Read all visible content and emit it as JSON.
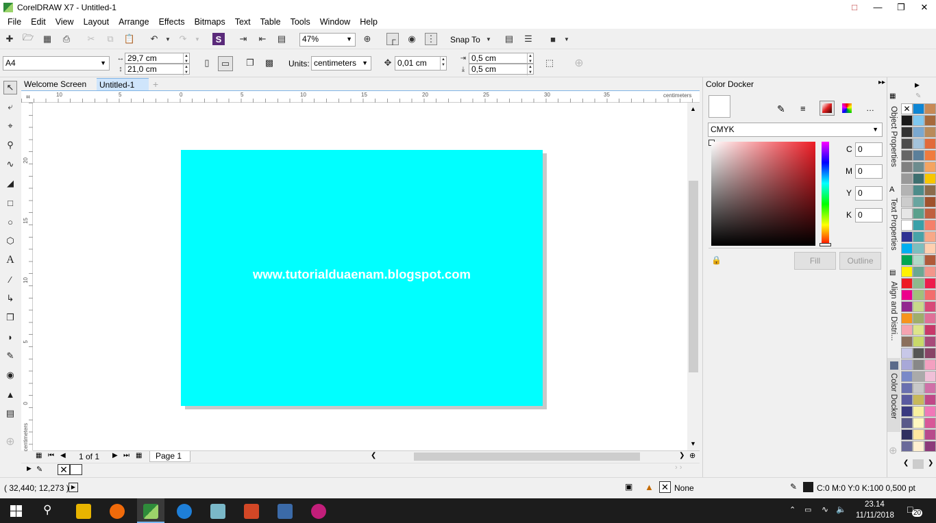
{
  "title": "CorelDRAW X7 - Untitled-1",
  "menu": [
    "File",
    "Edit",
    "View",
    "Layout",
    "Arrange",
    "Effects",
    "Bitmaps",
    "Text",
    "Table",
    "Tools",
    "Window",
    "Help"
  ],
  "toolbar": {
    "zoom": "47%",
    "snap": "Snap To"
  },
  "property_bar": {
    "page_size": "A4",
    "width": "29,7 cm",
    "height": "21,0 cm",
    "units_label": "Units:",
    "units": "centimeters",
    "nudge": "0,01 cm",
    "dup_x": "0,5 cm",
    "dup_y": "0,5 cm"
  },
  "tabs": {
    "welcome": "Welcome Screen",
    "doc": "Untitled-1"
  },
  "ruler": {
    "unit": "centimeters",
    "h_ticks": [
      "10",
      "5",
      "0",
      "5",
      "10",
      "15",
      "20",
      "25",
      "30",
      "35"
    ],
    "v_ticks": [
      "20",
      "15",
      "10",
      "5",
      "0"
    ]
  },
  "canvas": {
    "text": "www.tutorialduaenam.blogspot.com",
    "page_color": "#00FFFF"
  },
  "page_nav": {
    "count": "1 of 1",
    "page_tab": "Page 1"
  },
  "docker": {
    "title": "Color Docker",
    "model": "CMYK",
    "c_label": "C",
    "m_label": "M",
    "y_label": "Y",
    "k_label": "K",
    "c": "0",
    "m": "0",
    "y": "0",
    "k": "0",
    "fill": "Fill",
    "outline": "Outline"
  },
  "side_tabs": [
    "Object Properties",
    "Text Properties",
    "Align and Distri...",
    "Color Docker"
  ],
  "status": {
    "coords": "( 32,440; 12,273 )",
    "fill": "None",
    "outline": "C:0 M:0 Y:0 K:100  0,500 pt"
  },
  "taskbar": {
    "time": "23.14",
    "date": "11/11/2018",
    "notif": "20"
  },
  "palette_colors": [
    "#fff",
    "#0e86d4",
    "#c78a56",
    "#1a1a1a",
    "#7fc8f0",
    "#a66a3c",
    "#333",
    "#7aa8d0",
    "#b98b5a",
    "#4d4d4d",
    "#a3c3dc",
    "#e26a3a",
    "#666",
    "#5b7f9a",
    "#f07b3d",
    "#808080",
    "#6d8c8e",
    "#f4a460",
    "#999",
    "#3d6f6f",
    "#f8c700",
    "#b3b3b3",
    "#4d8c8a",
    "#8c6c4c",
    "#ccc",
    "#69a5a0",
    "#a0522d",
    "#e6e6e6",
    "#5aa08c",
    "#c06040",
    "#fff",
    "#3aa0a8",
    "#f5806a",
    "#2e3192",
    "#47a3a8",
    "#f8a888",
    "#00aeef",
    "#7bbfbf",
    "#ffd0b0",
    "#00a651",
    "#b0d8c8",
    "#b05a3a",
    "#fff200",
    "#6aa892",
    "#f2968c",
    "#ed1c24",
    "#8db98c",
    "#ed1c4c",
    "#ec008c",
    "#a2c07a",
    "#f36d6d",
    "#92278f",
    "#c8d88a",
    "#d84878",
    "#f7941d",
    "#9fae6a",
    "#e07098",
    "#f5a3b0",
    "#dde48a",
    "#c8386a",
    "#8b6f5c",
    "#c8d96a",
    "#a84a7a",
    "#c8c8e8",
    "#555",
    "#884466",
    "#a8a8d8",
    "#888",
    "#f4a0c0",
    "#7a8ac8",
    "#aaa",
    "#f0c0d8",
    "#6a70b0",
    "#c8c8c8",
    "#d070a8",
    "#5a5aa0",
    "#c8b85a",
    "#c04888",
    "#3a3a80",
    "#f8f0a0",
    "#f078b8",
    "#5a5a8a",
    "#fff8c0",
    "#d85898",
    "#303060",
    "#ffe8a0",
    "#b84a8c",
    "#6a6a9a",
    "#fff0d0",
    "#8c3a7a"
  ]
}
